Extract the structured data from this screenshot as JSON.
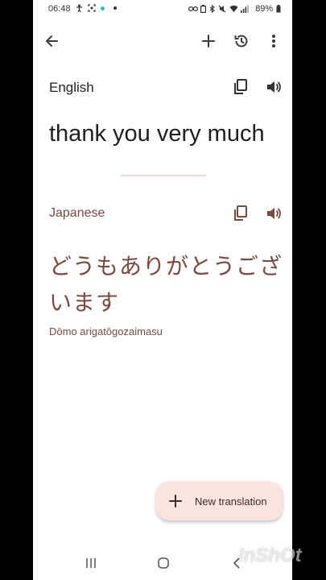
{
  "status_bar": {
    "time": "06:48",
    "battery": "89%"
  },
  "app_bar": {
    "back_icon": "arrow-left-icon",
    "add_icon": "plus-icon",
    "history_icon": "history-icon",
    "more_icon": "more-vertical-icon"
  },
  "source": {
    "language": "English",
    "text": "thank you very much"
  },
  "target": {
    "language": "Japanese",
    "text": "どうもありがとうございます",
    "romanization": "Dōmo arigatōgozaimasu"
  },
  "fab": {
    "label": "New translation",
    "icon": "plus-icon"
  },
  "nav_bar": {
    "recents_icon": "recents-icon",
    "home_icon": "home-icon",
    "back_icon": "nav-back-icon"
  },
  "watermark": "InShOt"
}
